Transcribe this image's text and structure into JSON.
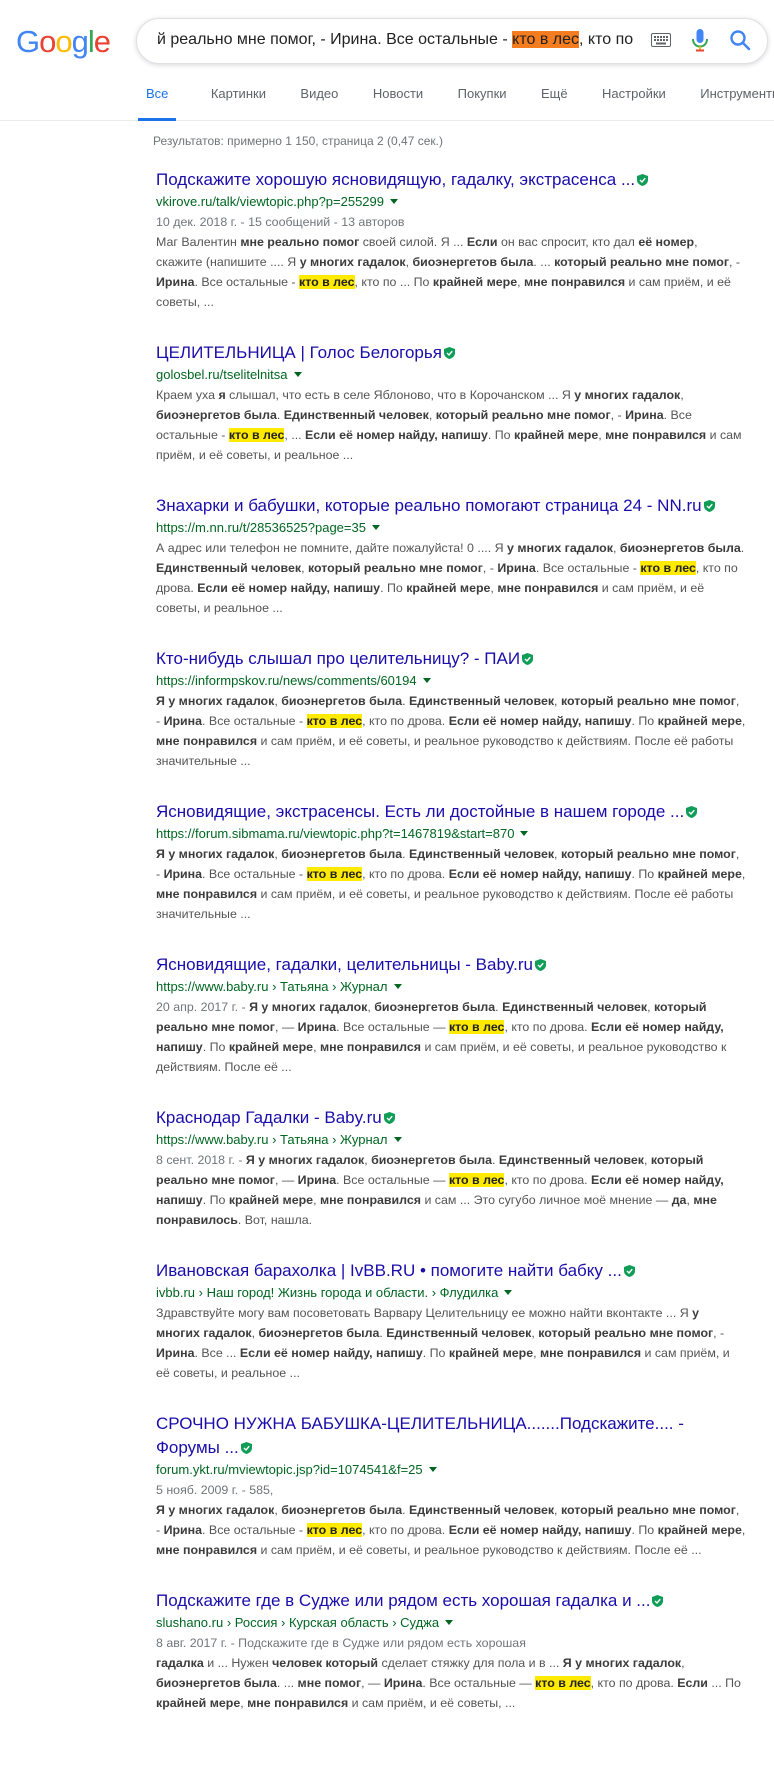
{
  "logo": {
    "letters": [
      "G",
      "o",
      "o",
      "g",
      "l",
      "e"
    ],
    "colors": [
      "#4285f4",
      "#ea4335",
      "#fbbc05",
      "#4285f4",
      "#34a853",
      "#ea4335"
    ]
  },
  "search": {
    "query_before": "й реально мне помог, - Ирина. Все остальные - ",
    "query_highlight": "кто в лес",
    "query_after": ", кто по"
  },
  "tabs": [
    {
      "label": "Все",
      "active": true
    },
    {
      "label": "Картинки"
    },
    {
      "label": "Видео"
    },
    {
      "label": "Новости"
    },
    {
      "label": "Покупки"
    },
    {
      "label": "Ещё"
    },
    {
      "label": "Настройки"
    },
    {
      "label": "Инструменты"
    }
  ],
  "stats": "Результатов: примерно 1 150, страница 2 (0,47 сек.)",
  "colors": {
    "link": "#1a0dab",
    "url": "#006621",
    "accent": "#1a73e8",
    "highlight": "#ffea00",
    "verify": "#0f9d58"
  },
  "results": [
    {
      "title": "Подскажите хорошую ясновидящую, гадалку, экстрасенса ...",
      "url": "vkirove.ru/talk/viewtopic.php?p=255299",
      "snippet": [
        {
          "t": "10 дек. 2018 г. - 15 сообщений - 13 авторов",
          "c": "date"
        },
        {
          "t": "Маг Валентин "
        },
        {
          "t": "мне реально помог",
          "b": true
        },
        {
          "t": " своей силой. Я ... "
        },
        {
          "t": "Если",
          "b": true
        },
        {
          "t": " он вас спросит, кто дал "
        },
        {
          "t": "её номер",
          "b": true
        },
        {
          "t": ", скажите (напишите .... Я "
        },
        {
          "t": "у многих гадалок",
          "b": true
        },
        {
          "t": ", "
        },
        {
          "t": "биоэнергетов была",
          "b": true
        },
        {
          "t": ". ... "
        },
        {
          "t": "который реально мне помог",
          "b": true
        },
        {
          "t": ", - "
        },
        {
          "t": "Ирина",
          "b": true
        },
        {
          "t": ". Все остальные - "
        },
        {
          "t": "кто в лес",
          "hl": true
        },
        {
          "t": ", кто по ... По "
        },
        {
          "t": "крайней мере",
          "b": true
        },
        {
          "t": ", "
        },
        {
          "t": "мне понравился",
          "b": true
        },
        {
          "t": " и сам приём, и её советы, ..."
        }
      ]
    },
    {
      "title": "ЦЕЛИТЕЛЬНИЦА | Голос Белогорья",
      "url": "golosbel.ru/tselitelnitsa",
      "snippet": [
        {
          "t": "Краем уха "
        },
        {
          "t": "я",
          "b": true
        },
        {
          "t": " слышал, что есть в селе Яблоново, что в Корочанском ... Я "
        },
        {
          "t": "у многих гадалок",
          "b": true
        },
        {
          "t": ", "
        },
        {
          "t": "биоэнергетов была",
          "b": true
        },
        {
          "t": ". "
        },
        {
          "t": "Единственный человек",
          "b": true
        },
        {
          "t": ", "
        },
        {
          "t": "который реально мне помог",
          "b": true
        },
        {
          "t": ", - "
        },
        {
          "t": "Ирина",
          "b": true
        },
        {
          "t": ". Все остальные - "
        },
        {
          "t": "кто в лес",
          "hl": true
        },
        {
          "t": ", ... "
        },
        {
          "t": "Если её номер найду, напишу",
          "b": true
        },
        {
          "t": ". По "
        },
        {
          "t": "крайней мере",
          "b": true
        },
        {
          "t": ", "
        },
        {
          "t": "мне понравился",
          "b": true
        },
        {
          "t": " и сам приём, и её советы, и реальное ..."
        }
      ]
    },
    {
      "title": "Знахарки и бабушки, которые реально помогают страница 24 - NN.ru",
      "url": "https://m.nn.ru/t/28536525?page=35",
      "snippet": [
        {
          "t": "А адрес или телефон не помните, дайте пожалуйста! 0 .... Я "
        },
        {
          "t": "у многих гадалок",
          "b": true
        },
        {
          "t": ", "
        },
        {
          "t": "биоэнергетов была",
          "b": true
        },
        {
          "t": ". "
        },
        {
          "t": "Единственный человек",
          "b": true
        },
        {
          "t": ", "
        },
        {
          "t": "который реально мне помог",
          "b": true
        },
        {
          "t": ", - "
        },
        {
          "t": "Ирина",
          "b": true
        },
        {
          "t": ". Все остальные - "
        },
        {
          "t": "кто в лес",
          "hl": true
        },
        {
          "t": ", кто по дрова. "
        },
        {
          "t": "Если её номер найду, напишу",
          "b": true
        },
        {
          "t": ". По "
        },
        {
          "t": "крайней мере",
          "b": true
        },
        {
          "t": ", "
        },
        {
          "t": "мне понравился",
          "b": true
        },
        {
          "t": " и сам приём, и её советы, и реальное ..."
        }
      ]
    },
    {
      "title": "Кто-нибудь слышал про целительницу? - ПАИ",
      "url": "https://informpskov.ru/news/comments/60194",
      "snippet": [
        {
          "t": "Я у многих гадалок",
          "b": true
        },
        {
          "t": ", "
        },
        {
          "t": "биоэнергетов была",
          "b": true
        },
        {
          "t": ". "
        },
        {
          "t": "Единственный человек",
          "b": true
        },
        {
          "t": ", "
        },
        {
          "t": "который реально мне помог",
          "b": true
        },
        {
          "t": ", - "
        },
        {
          "t": "Ирина",
          "b": true
        },
        {
          "t": ". Все остальные - "
        },
        {
          "t": "кто в лес",
          "hl": true
        },
        {
          "t": ", кто по дрова. "
        },
        {
          "t": "Если её номер найду, напишу",
          "b": true
        },
        {
          "t": ". По "
        },
        {
          "t": "крайней мере",
          "b": true
        },
        {
          "t": ", "
        },
        {
          "t": "мне понравился",
          "b": true
        },
        {
          "t": " и сам приём, и её советы, и реальное руководство к действиям. После её работы значительные ..."
        }
      ]
    },
    {
      "title": "Ясновидящие, экстрасенсы. Есть ли достойные в нашем городе ...",
      "url": "https://forum.sibmama.ru/viewtopic.php?t=1467819&start=870",
      "snippet": [
        {
          "t": "Я у многих гадалок",
          "b": true
        },
        {
          "t": ", "
        },
        {
          "t": "биоэнергетов была",
          "b": true
        },
        {
          "t": ". "
        },
        {
          "t": "Единственный человек",
          "b": true
        },
        {
          "t": ", "
        },
        {
          "t": "который реально мне помог",
          "b": true
        },
        {
          "t": ", - "
        },
        {
          "t": "Ирина",
          "b": true
        },
        {
          "t": ". Все остальные - "
        },
        {
          "t": "кто в лес",
          "hl": true
        },
        {
          "t": ", кто по дрова. "
        },
        {
          "t": "Если её номер найду, напишу",
          "b": true
        },
        {
          "t": ". По "
        },
        {
          "t": "крайней мере",
          "b": true
        },
        {
          "t": ", "
        },
        {
          "t": "мне понравился",
          "b": true
        },
        {
          "t": " и сам приём, и её советы, и реальное руководство к действиям. После её работы значительные ..."
        }
      ]
    },
    {
      "title": "Ясновидящие, гадалки, целительницы - Baby.ru",
      "url": "https://www.baby.ru › Татьяна › Журнал",
      "snippet": [
        {
          "t": "20 апр. 2017 г. - ",
          "c": "date"
        },
        {
          "t": "Я у многих гадалок",
          "b": true
        },
        {
          "t": ", "
        },
        {
          "t": "биоэнергетов была",
          "b": true
        },
        {
          "t": ". "
        },
        {
          "t": "Единственный человек",
          "b": true
        },
        {
          "t": ", "
        },
        {
          "t": "который реально мне помог",
          "b": true
        },
        {
          "t": ", — "
        },
        {
          "t": "Ирина",
          "b": true
        },
        {
          "t": ". Все остальные — "
        },
        {
          "t": "кто в лес",
          "hl": true
        },
        {
          "t": ", кто по дрова. "
        },
        {
          "t": "Если её номер найду, напишу",
          "b": true
        },
        {
          "t": ". По "
        },
        {
          "t": "крайней мере",
          "b": true
        },
        {
          "t": ", "
        },
        {
          "t": "мне понравился",
          "b": true
        },
        {
          "t": " и сам приём, и её советы, и реальное руководство к действиям. После её ..."
        }
      ]
    },
    {
      "title": "Краснодар Гадалки - Baby.ru",
      "url": "https://www.baby.ru › Татьяна › Журнал",
      "snippet": [
        {
          "t": "8 сент. 2018 г. - ",
          "c": "date"
        },
        {
          "t": "Я у многих гадалок",
          "b": true
        },
        {
          "t": ", "
        },
        {
          "t": "биоэнергетов была",
          "b": true
        },
        {
          "t": ". "
        },
        {
          "t": "Единственный человек",
          "b": true
        },
        {
          "t": ", "
        },
        {
          "t": "который реально мне помог",
          "b": true
        },
        {
          "t": ", — "
        },
        {
          "t": "Ирина",
          "b": true
        },
        {
          "t": ". Все остальные — "
        },
        {
          "t": "кто в лес",
          "hl": true
        },
        {
          "t": ", кто по дрова. "
        },
        {
          "t": "Если её номер найду, напишу",
          "b": true
        },
        {
          "t": ". По "
        },
        {
          "t": "крайней мере",
          "b": true
        },
        {
          "t": ", "
        },
        {
          "t": "мне понравился",
          "b": true
        },
        {
          "t": " и сам ... Это сугубо личное моё мнение — "
        },
        {
          "t": "да",
          "b": true
        },
        {
          "t": ", "
        },
        {
          "t": "мне понравилось",
          "b": true
        },
        {
          "t": ". Вот, нашла."
        }
      ]
    },
    {
      "title": "Ивановская барахолка | IvBB.RU • помогите найти бабку ...",
      "url": "ivbb.ru › Наш город! Жизнь города и области. › Флудилка",
      "snippet": [
        {
          "t": "Здравствуйте могу вам посоветовать Варвару Целительницу ее можно найти вконтакте ... Я "
        },
        {
          "t": "у многих гадалок",
          "b": true
        },
        {
          "t": ", "
        },
        {
          "t": "биоэнергетов была",
          "b": true
        },
        {
          "t": ". "
        },
        {
          "t": "Единственный человек",
          "b": true
        },
        {
          "t": ", "
        },
        {
          "t": "который реально мне помог",
          "b": true
        },
        {
          "t": ", - "
        },
        {
          "t": "Ирина",
          "b": true
        },
        {
          "t": ". Все ... "
        },
        {
          "t": "Если её номер найду, напишу",
          "b": true
        },
        {
          "t": ". По "
        },
        {
          "t": "крайней мере",
          "b": true
        },
        {
          "t": ", "
        },
        {
          "t": "мне понравился",
          "b": true
        },
        {
          "t": " и сам приём, и её советы, и реальное ..."
        }
      ]
    },
    {
      "title": "СРОЧНО НУЖНА БАБУШКА-ЦЕЛИТЕЛЬНИЦА.......Подскажите.... - Форумы ...",
      "url": "forum.ykt.ru/mviewtopic.jsp?id=1074541&f=25",
      "snippet": [
        {
          "t": "5 нояб. 2009 г. - 585, ",
          "c": "date"
        },
        {
          "t": "Я у многих гадалок",
          "b": true
        },
        {
          "t": ", "
        },
        {
          "t": "биоэнергетов была",
          "b": true
        },
        {
          "t": ". "
        },
        {
          "t": "Единственный человек",
          "b": true
        },
        {
          "t": ", "
        },
        {
          "t": "который реально мне помог",
          "b": true
        },
        {
          "t": ", - "
        },
        {
          "t": "Ирина",
          "b": true
        },
        {
          "t": ". Все остальные - "
        },
        {
          "t": "кто в лес",
          "hl": true
        },
        {
          "t": ", кто по дрова. "
        },
        {
          "t": "Если её номер найду, напишу",
          "b": true
        },
        {
          "t": ". По "
        },
        {
          "t": "крайней мере",
          "b": true
        },
        {
          "t": ", "
        },
        {
          "t": "мне понравился",
          "b": true
        },
        {
          "t": " и сам приём, и её советы, и реальное руководство к действиям. После её ..."
        }
      ]
    },
    {
      "title": "Подскажите где в Судже или рядом есть хорошая гадалка и ...",
      "url": "slushano.ru › Россия › Курская область › Суджа",
      "snippet": [
        {
          "t": "8 авг. 2017 г. - Подскажите где в Судже или рядом есть хорошая ",
          "c": "date"
        },
        {
          "t": "гадалка",
          "b": true
        },
        {
          "t": " и ... Нужен "
        },
        {
          "t": "человек который",
          "b": true
        },
        {
          "t": " сделает стяжку для пола и в ... "
        },
        {
          "t": "Я у многих гадалок",
          "b": true
        },
        {
          "t": ", "
        },
        {
          "t": "биоэнергетов была",
          "b": true
        },
        {
          "t": ". ... "
        },
        {
          "t": "мне помог",
          "b": true
        },
        {
          "t": ", — "
        },
        {
          "t": "Ирина",
          "b": true
        },
        {
          "t": ". Все остальные — "
        },
        {
          "t": "кто в лес",
          "hl": true
        },
        {
          "t": ", кто по дрова. "
        },
        {
          "t": "Если",
          "b": true
        },
        {
          "t": " ... По "
        },
        {
          "t": "крайней мере",
          "b": true
        },
        {
          "t": ", "
        },
        {
          "t": "мне понравился",
          "b": true
        },
        {
          "t": " и сам приём, и её советы, ..."
        }
      ]
    }
  ]
}
